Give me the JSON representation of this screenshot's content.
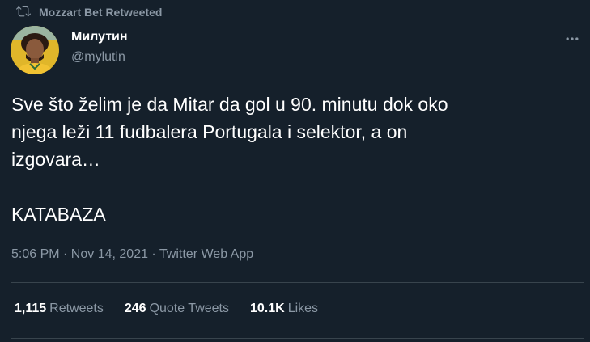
{
  "retweet": {
    "text": "Mozzart Bet Retweeted"
  },
  "author": {
    "name": "Милутин",
    "handle": "@mylutin"
  },
  "tweet": {
    "text": "Sve što želim je da Mitar da gol u 90. minutu dok oko\nnjega leži 11 fudbalera Portugala i selektor, a on\nizgovara…\n\nKATABAZA",
    "meta": "5:06 PM · Nov 14, 2021 · Twitter Web App"
  },
  "stats": {
    "retweets": {
      "value": "1,115",
      "label": "Retweets"
    },
    "quote_tweets": {
      "value": "246",
      "label": "Quote Tweets"
    },
    "likes": {
      "value": "10.1K",
      "label": "Likes"
    }
  },
  "icons": {
    "retweet": "retweet-icon",
    "more": "more-options-icon",
    "avatar": "avatar-image"
  },
  "colors": {
    "background": "#15202b",
    "text_primary": "#ffffff",
    "text_secondary": "#8b98a5",
    "divider": "#38444d"
  }
}
